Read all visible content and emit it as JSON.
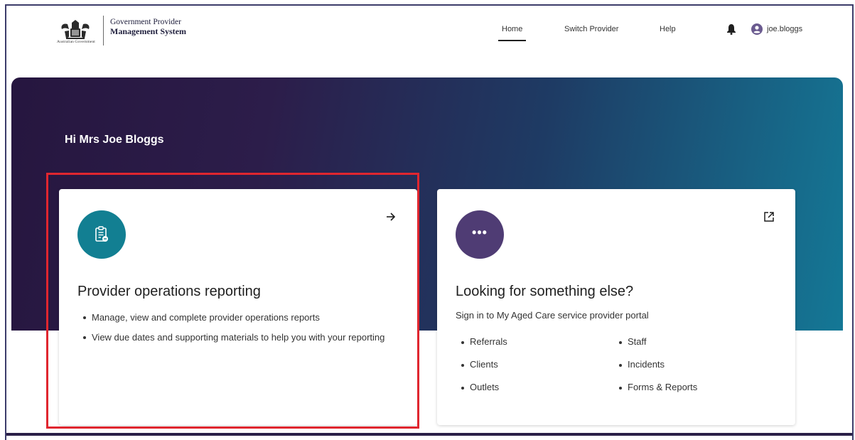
{
  "header": {
    "crest_caption": "Australian Government",
    "brand_line1": "Government Provider",
    "brand_line2": "Management System",
    "nav": {
      "home": "Home",
      "switch_provider": "Switch Provider",
      "help": "Help"
    },
    "active_nav": "Home",
    "username": "joe.bloggs",
    "icons": [
      "australian-government-crest",
      "bell-icon",
      "user-avatar-icon"
    ]
  },
  "hero": {
    "greeting": "Hi Mrs Joe Bloggs"
  },
  "cards": {
    "reporting": {
      "icon": "clipboard-icon",
      "action_icon": "arrow-right-icon",
      "title": "Provider operations reporting",
      "bullets": [
        "Manage, view and complete provider operations reports",
        "View due dates and supporting materials to help you with your reporting"
      ]
    },
    "other": {
      "icon": "more-dots-icon",
      "action_icon": "external-link-icon",
      "title": "Looking for something else?",
      "subtitle": "Sign in to My Aged Care service provider portal",
      "links": [
        "Referrals",
        "Staff",
        "Clients",
        "Incidents",
        "Outlets",
        "Forms & Reports"
      ]
    }
  },
  "colors": {
    "hero_start": "#26163f",
    "hero_end": "#147896",
    "teal": "#127f92",
    "purple": "#4f3c74",
    "highlight": "#e0262f"
  }
}
